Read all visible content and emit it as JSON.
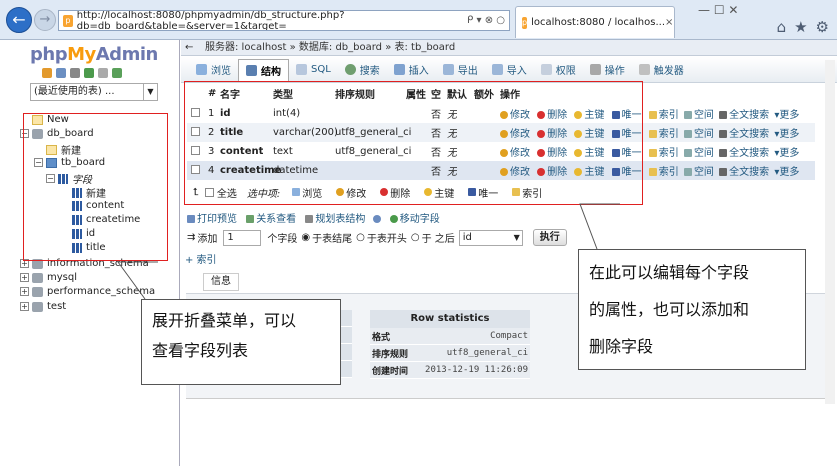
{
  "browser": {
    "url": "http://localhost:8080/phpmyadmin/db_structure.php?db=db_board&table=&server=1&target=",
    "url_tail": "ᑭ ▾ ⊗ ○",
    "tab_title": "localhost:8080 / localhos...",
    "tab_close": "×",
    "window_controls": "— ☐ ✕"
  },
  "logo": {
    "php": "php",
    "my": "My",
    "admin": "Admin"
  },
  "left": {
    "recent": "(最近使用的表) ...",
    "tree": [
      {
        "label": "New"
      },
      {
        "label": "db_board"
      },
      {
        "label": "新建"
      },
      {
        "label": "tb_board"
      },
      {
        "label": "字段"
      },
      {
        "label": "新建"
      },
      {
        "label": "content"
      },
      {
        "label": "createtime"
      },
      {
        "label": "id"
      },
      {
        "label": "title"
      },
      {
        "label": "information_schema"
      },
      {
        "label": "mysql"
      },
      {
        "label": "performance_schema"
      },
      {
        "label": "test"
      }
    ]
  },
  "main": {
    "breadcrumb": "服务器: localhost » 数据库: db_board » 表: tb_board",
    "tabs": [
      "浏览",
      "结构",
      "SQL",
      "搜索",
      "插入",
      "导出",
      "导入",
      "权限",
      "操作",
      "触发器"
    ],
    "headers": [
      "#",
      "名字",
      "类型",
      "排序规则",
      "属性",
      "空",
      "默认",
      "额外",
      "操作"
    ],
    "rows": [
      {
        "num": "1",
        "name": "id",
        "type": "int(4)",
        "collation": "",
        "null": "否",
        "default": "无"
      },
      {
        "num": "2",
        "name": "title",
        "type": "varchar(200)",
        "collation": "utf8_general_ci",
        "null": "否",
        "default": "无"
      },
      {
        "num": "3",
        "name": "content",
        "type": "text",
        "collation": "utf8_general_ci",
        "null": "否",
        "default": "无"
      },
      {
        "num": "4",
        "name": "createtime",
        "type": "datetime",
        "collation": "",
        "null": "否",
        "default": "无"
      }
    ],
    "row_actions": [
      "修改",
      "删除",
      "主键",
      "唯一",
      "索引",
      "空间",
      "全文搜索",
      "更多"
    ],
    "bulk": {
      "check_all": "全选",
      "selected": "选中项:",
      "browse": "浏览",
      "edit": "修改",
      "delete": "删除",
      "primary": "主键",
      "unique": "唯一",
      "index": "索引"
    },
    "links": [
      "打印预览",
      "关系查看",
      "规划表结构",
      "移动字段"
    ],
    "add": {
      "label": "添加",
      "count": "1",
      "unit": "个字段",
      "opt_end": "于表结尾",
      "opt_start": "于表开头",
      "opt_after": "于 之后",
      "after_field": "id",
      "go": "执行"
    },
    "add_index": "+ 索引",
    "info": "信息",
    "row_stats": {
      "title": "Row statistics",
      "rows": [
        {
          "k": "格式",
          "v": "Compact"
        },
        {
          "k": "排序规则",
          "v": "utf8_general_ci"
        },
        {
          "k": "创建时间",
          "v": "2013-12-19 11:26:09"
        }
      ]
    }
  },
  "callouts": {
    "left": [
      "展开折叠菜单，可以",
      "查看字段列表"
    ],
    "right": [
      "在此可以编辑每个字段",
      "的属性，也可以添加和",
      "删除字段"
    ]
  }
}
